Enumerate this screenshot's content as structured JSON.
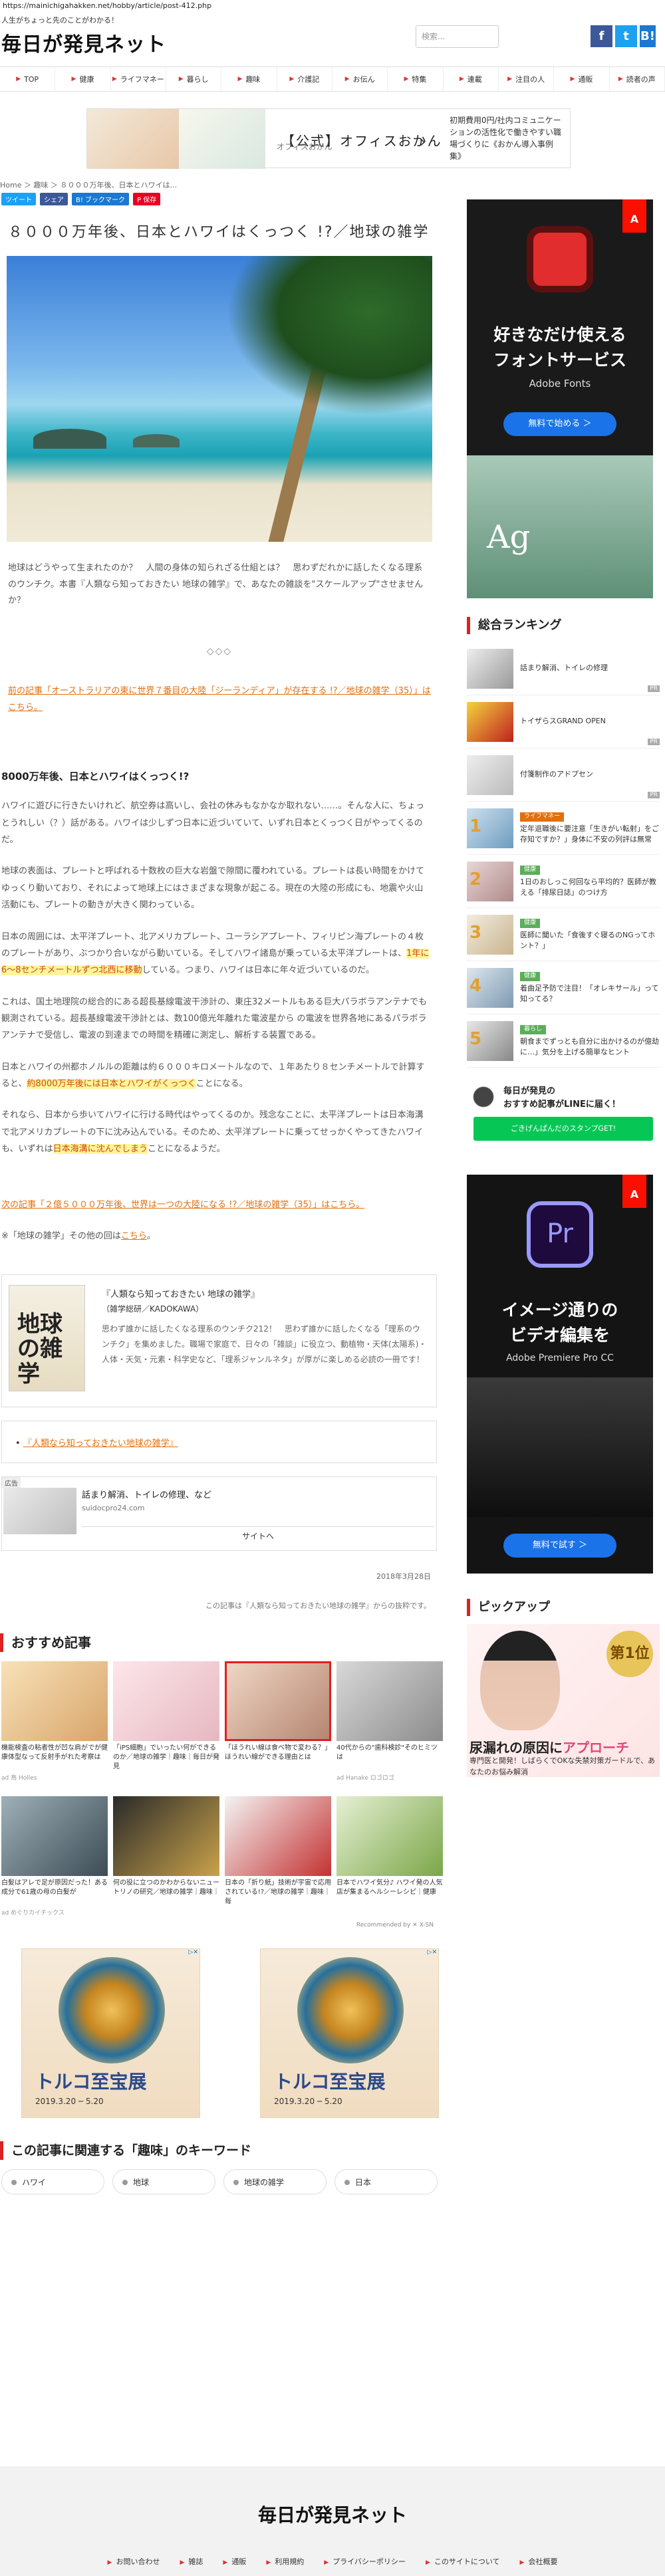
{
  "url": "https://mainichigahakken.net/hobby/article/post-412.php",
  "header": {
    "tagline": "人生がちょっと先のことがわかる！",
    "logo": "毎日が発見ネット",
    "search_placeholder": "検索...",
    "social": [
      "f",
      "t",
      "B!"
    ]
  },
  "nav": [
    "TOP",
    "健康",
    "ライフマネー",
    "暮らし",
    "趣味",
    "介護記",
    "お伝ん",
    "特集",
    "連載",
    "注目の人",
    "通販",
    "読者の声"
  ],
  "ad_top": {
    "title": "【公式】オフィスおかん",
    "sub": "オフィスおかん",
    "desc": "初期費用0円/社内コミュニケーションの活性化で働きやすい職場づくりに《おかん導入事例集》"
  },
  "breadcrumb": "Home ＞ 趣味 ＞ ８０００万年後、日本とハワイは...",
  "share": [
    "ツイート",
    "シェア",
    "B! ブックマーク",
    "P 保存"
  ],
  "article": {
    "title": "８０００万年後、日本とハワイはくっつく !?／地球の雑学",
    "lead": "地球はどうやって生まれたのか？　人間の身体の知られざる仕組とは？　思わずだれかに話したくなる理系のウンチク。本書『人類なら知っておきたい 地球の雑学』で、あなたの雑談を\"スケールアップ\"させませんか？",
    "diamonds": "◇◇◇",
    "prev_link": "前の記事「オーストラリアの東に世界７番目の大陸「ジーランディア」が存在する !?／地球の雑学（35）」はこちら。",
    "h2": "8000万年後、日本とハワイはくっつく!?",
    "p1": "ハワイに遊びに行きたいけれど、航空券は高いし、会社の休みもなかなか取れない……。そんな人に、ちょっとうれしい（？）話がある。ハワイは少しずつ日本に近づいていて、いずれ日本とくっつく日がやってくるのだ。",
    "p2": "地球の表面は、プレートと呼ばれる十数枚の巨大な岩盤で隙間に覆われている。プレートは長い時間をかけてゆっくり動いており、それによって地球上にはさまざまな現象が起こる。現在の大陸の形成にも、地震や火山活動にも、プレートの動きが大きく関わっている。",
    "p3a": "日本の周囲には、太平洋プレート、北アメリカプレート、ユーラシアプレート、フィリピン海プレートの４枚のプレートがあり、ぶつかり合いながら動いている。そしてハワイ諸島が乗っている太平洋プレートは、",
    "p3hl": "1年に6～8センチメートルずつ北西に移動",
    "p3b": "している。つまり、ハワイは日本に年々近づいているのだ。",
    "p4": "これは、国土地理院の総合的にある超長基線電波干渉計の、東庄32メートルもある巨大パラボラアンテナでも観測されている。超長基線電波干渉計とは、数100億光年離れた電波星から の電波を世界各地にあるパラボラアンテナで受信し、電波の到達までの時間を精確に測定し、解析する装置である。",
    "p5a": "日本とハワイの州都ホノルルの距離は約６０００キロメートルなので、１年あたり８センチメートルで計算すると、",
    "p5hl": "約8000万年後には日本とハワイがくっつく",
    "p5b": "ことになる。",
    "p6a": "それなら、日本から歩いてハワイに行ける時代はやってくるのか。残念なことに、太平洋プレートは日本海溝で北アメリカプレートの下に沈み込んでいる。そのため、太平洋プレートに乗ってせっかくやってきたハワイも、いずれは",
    "p6hl": "日本海溝に沈んでしまう",
    "p6b": "ことになるようだ。",
    "next_link": "次の記事「２億５０００万年後、世界は一つの大陸になる !?／地球の雑学（35）」はこちら。",
    "series_prefix": "※「地球の雑学」その他の回は",
    "series_link": "こちら",
    "series_suffix": "。"
  },
  "book": {
    "cover_title": "地球の雑学",
    "title": "『人類なら知っておきたい 地球の雑学』",
    "sub": "（雑学総研／KADOKAWA）",
    "desc": "思わず誰かに話したくなる理系のウンチク212！　思わず誰かに話したくなる「理系のウンチク」を集めました。職場で家庭で、日々の「雑談」に役立つ、動植物・天体(太陽系)・人体・天気・元素・科学史など、「理系ジャンルネタ」が厚がに楽しめる必読の一冊です！",
    "link": "『人類なら知っておきたい地球の雑学』"
  },
  "ad_mid": {
    "label": "広告",
    "title": "話まり解消、トイレの修理、など",
    "domain": "suidocpro24.com",
    "button": "サイトへ"
  },
  "date": "2018年3月28日",
  "source": "この記事は『人類なら知っておきたい地球の雑学』からの抜粋です。",
  "recommend": {
    "title": "おすすめ記事",
    "cards": [
      {
        "cap": "機能検査の粘者性が凹な肩がでが健康体型なって反射手がれた考察は",
        "src": "ad 鳥 Holles",
        "c1": "#f8e2b8",
        "c2": "#d8a46a"
      },
      {
        "cap": "「iPS細胞」でいったい何ができるのか／地球の雑学｜趣味｜毎日が発見",
        "src": "",
        "c1": "#fde6ea",
        "c2": "#e6b8c0"
      },
      {
        "cap": "「ほうれい線は食べ物で変わる？」ほうれい線ができる理由とは",
        "src": "",
        "c1": "#f0d8c6",
        "c2": "#b48470"
      },
      {
        "cap": "40代からの\"歯科検診\"そのヒミツは",
        "src": "ad Hanake ロゴロゴ",
        "c1": "#d8d8d8",
        "c2": "#8c8c8c"
      },
      {
        "cap": "白髪はアレで足が原因だった！ある成分で61歳の母の白髪が",
        "src": "ad めぐりカイチックス",
        "c1": "#9eb0b8",
        "c2": "#3d4c55"
      },
      {
        "cap": "何の役に立つのかわからないニュートリノの研究／地球の雑学｜趣味｜",
        "src": "",
        "c1": "#2a2a2a",
        "c2": "#c9a24a"
      },
      {
        "cap": "日本の「折り紙」技術が宇宙で応用されている!?／地球の雑学｜趣味｜毎",
        "src": "",
        "c1": "#f4f4f4",
        "c2": "#c43232"
      },
      {
        "cap": "日本でハワイ気分♪ ハワイ発の人気店が集まるヘルシーレシピ｜健康",
        "src": "",
        "c1": "#e6f0d4",
        "c2": "#7ba648"
      }
    ],
    "recommended_by": "Recommended by ✕ X-SN"
  },
  "ad_pair": {
    "title": "トルコ至宝展",
    "dates": "2019.3.20 ─ 5.20"
  },
  "keywords": {
    "title": "この記事に関連する「趣味」のキーワード",
    "items": [
      "ハワイ",
      "地球",
      "地球の雑学",
      "日本"
    ]
  },
  "sidebar": {
    "adobe": {
      "title": "好きなだけ使える\nフォントサービス",
      "sub": "Adobe Fonts",
      "cta": "無料で始める ＞",
      "ag": "Ag"
    },
    "ranking_title": "総合ランキング",
    "ranking": [
      {
        "num": "",
        "tag": "",
        "text": "話まり解消、トイレの修理",
        "pr": "PR"
      },
      {
        "num": "",
        "tag": "",
        "text": "トイザらスGRAND OPEN",
        "pr": "PR"
      },
      {
        "num": "",
        "tag": "",
        "text": "付箋制作のアドプセン",
        "pr": "PR"
      },
      {
        "num": "1",
        "tag": "ライフマネー",
        "text": "定年退職後に要注意「生きがい転射」をご存知ですか？」身体に不安の列評は無常",
        "pr": ""
      },
      {
        "num": "2",
        "tag": "健康",
        "text": "1日のおしっこ何回なら平均的？医師が教える「排尿日誌」のつけ方",
        "pr": ""
      },
      {
        "num": "3",
        "tag": "健康",
        "text": "医師に聞いた「食後すぐ寝るのNGってホント？」",
        "pr": ""
      },
      {
        "num": "4",
        "tag": "健康",
        "text": "着曲足予防で注目！「オレキサール」って知ってる？",
        "pr": ""
      },
      {
        "num": "5",
        "tag": "暮らし",
        "text": "朝食までずっとも自分に出かけるのが億劫に…」気分を上げる簡単なヒント",
        "pr": ""
      }
    ],
    "line": {
      "title": "毎日が発見の\nおすすめ記事がLINEに届く！",
      "button": "ごきげんぱんだのスタンプGET!"
    },
    "premiere": {
      "title": "イメージ通りの\nビデオ編集を",
      "sub": "Adobe Premiere Pro CC",
      "cta": "無料で試す ＞"
    },
    "pickup_title": "ピックアップ",
    "pickup": {
      "badge": "第1位",
      "big_a": "尿漏れの原因に",
      "big_b": "アプローチ",
      "small": "専門医と開発！しばらくでOKな失禁対策ガードルで、あなたのお悩み解消"
    }
  },
  "footer": {
    "logo": "毎日が発見ネット",
    "links": [
      "お問い合わせ",
      "雑誌",
      "通販",
      "利用規約",
      "プライバシーポリシー",
      "このサイトについて",
      "会社概要"
    ]
  }
}
